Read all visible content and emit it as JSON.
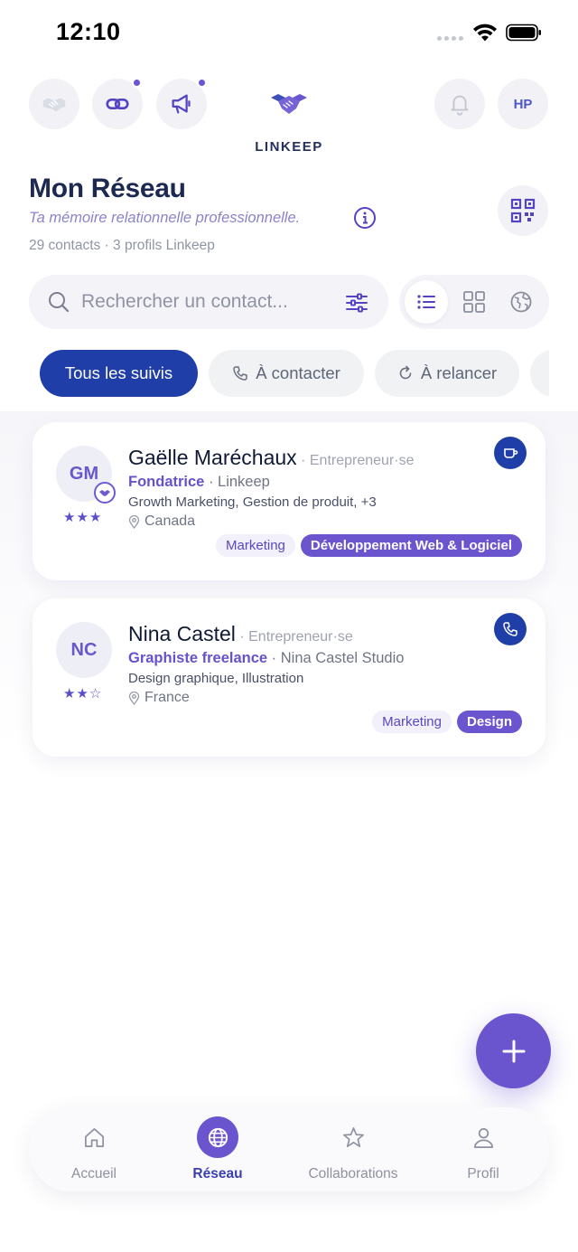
{
  "status_bar": {
    "time": "12:10"
  },
  "header": {
    "brand": "LINKEEP",
    "avatar_initials": "HP"
  },
  "page": {
    "title": "Mon Réseau",
    "subtitle": "Ta mémoire relationnelle professionnelle.",
    "stats": "29 contacts · 3 profils Linkeep"
  },
  "search": {
    "placeholder": "Rechercher un contact..."
  },
  "filters": [
    {
      "label": "Tous les suivis"
    },
    {
      "label": "À contacter"
    },
    {
      "label": "À relancer"
    }
  ],
  "contacts": [
    {
      "initials": "GM",
      "name": "Gaëlle Maréchaux",
      "type": "· Entrepreneur·se",
      "role": "Fondatrice",
      "company": "· Linkeep",
      "skills": "Growth Marketing,  Gestion de produit,  +3",
      "location": "Canada",
      "stars": "★★★",
      "rating": 3,
      "action": "coffee-icon",
      "tags": [
        "Marketing",
        "Développement Web & Logiciel"
      ]
    },
    {
      "initials": "NC",
      "name": "Nina Castel",
      "type": "· Entrepreneur·se",
      "role": "Graphiste freelance",
      "company": "· Nina Castel Studio",
      "skills": "Design graphique,  Illustration",
      "location": "France",
      "stars": "★★☆",
      "rating": 2,
      "action": "phone-icon",
      "tags": [
        "Marketing",
        "Design"
      ]
    }
  ],
  "bottom_nav": [
    {
      "label": "Accueil",
      "icon": "home-icon"
    },
    {
      "label": "Réseau",
      "icon": "globe-icon",
      "active": true
    },
    {
      "label": "Collaborations",
      "icon": "star-icon"
    },
    {
      "label": "Profil",
      "icon": "user-icon"
    }
  ],
  "colors": {
    "primary": "#6b55cf",
    "navy": "#1f3ea8",
    "title": "#1c2a52"
  }
}
